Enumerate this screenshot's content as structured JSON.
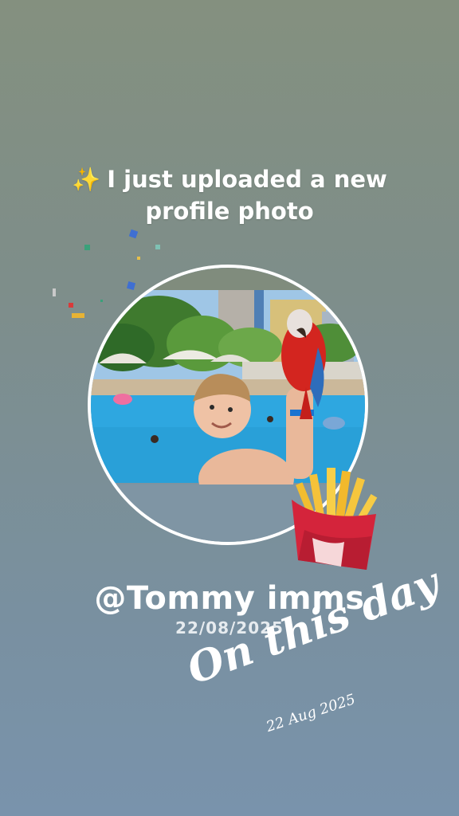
{
  "story": {
    "headline_icon": "sparkles-icon",
    "headline": "I just uploaded a new profile photo",
    "username": "@Tommy imms",
    "date": "22/08/2025",
    "on_this_day": "On this day",
    "on_this_day_date": "22 Aug 2025",
    "sticker": "fries-icon"
  },
  "colors": {
    "bg_top": "#84907f",
    "bg_bottom": "#7993ac",
    "text": "#ffffff",
    "sparkle": "#f7d14a"
  }
}
